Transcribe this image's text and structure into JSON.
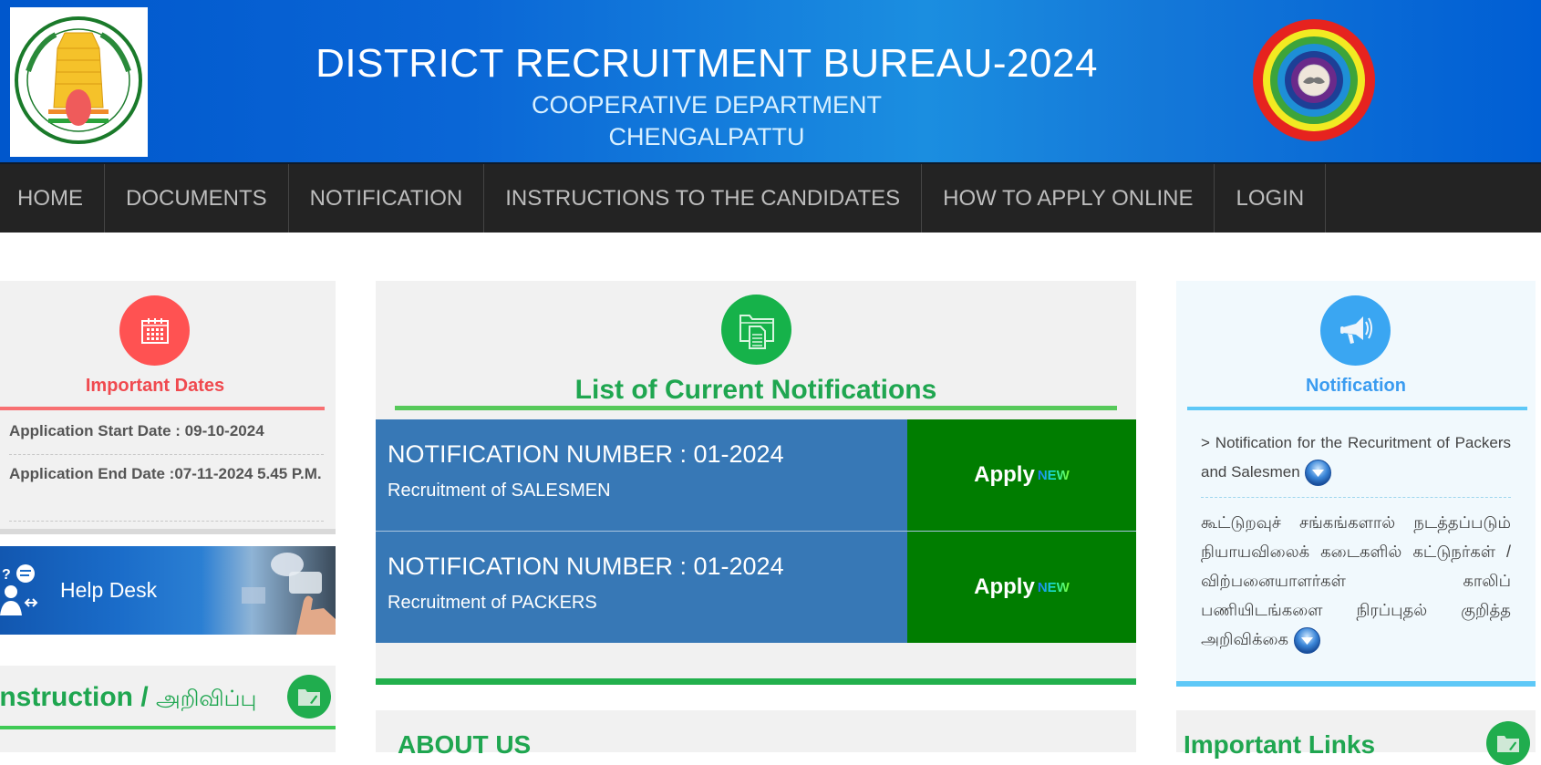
{
  "header": {
    "title": "DISTRICT RECRUITMENT BUREAU-2024",
    "subtitle_line1": "COOPERATIVE DEPARTMENT",
    "subtitle_line2": "CHENGALPATTU",
    "left_logo": "tamil-nadu-emblem",
    "right_logo": "cooperative-rainbow-logo"
  },
  "nav": {
    "items": [
      {
        "label": "HOME"
      },
      {
        "label": "DOCUMENTS"
      },
      {
        "label": "NOTIFICATION"
      },
      {
        "label": "INSTRUCTIONS TO THE CANDIDATES"
      },
      {
        "label": "HOW TO APPLY ONLINE"
      },
      {
        "label": "LOGIN"
      }
    ]
  },
  "important_dates": {
    "icon": "calendar-icon",
    "heading": "Important Dates",
    "start_date": "Application Start Date : 09-10-2024",
    "end_date": "Application End Date :07-11-2024 5.45 P.M."
  },
  "helpdesk": {
    "label": "Help Desk"
  },
  "instruction": {
    "title_en": "Instruction /",
    "title_ta": "அறிவிப்பு",
    "icon": "folder-icon"
  },
  "current_notifications": {
    "icon": "documents-folder-icon",
    "heading": "List of Current Notifications",
    "items": [
      {
        "number": "NOTIFICATION NUMBER : 01-2024",
        "description": "Recruitment of SALESMEN",
        "apply_label": "Apply",
        "badge": "NEW"
      },
      {
        "number": "NOTIFICATION NUMBER : 01-2024",
        "description": "Recruitment of PACKERS",
        "apply_label": "Apply",
        "badge": "NEW"
      }
    ]
  },
  "about": {
    "title": "ABOUT US"
  },
  "notification_panel": {
    "icon": "megaphone-icon",
    "heading": "Notification",
    "english_text": "> Notification for the Recuritment of Packers and Salesmen",
    "tamil_text": "கூட்டுறவுச் சங்கங்களால் நடத்தப்படும் நியாயவிலைக் கடைகளில் கட்டுநர்கள் / விற்பனையாளர்கள் காலிப் பணியிடங்களை நிரப்புதல் குறித்த அறிவிக்கை"
  },
  "important_links": {
    "title": "Important Links",
    "icon": "folder-icon"
  },
  "colors": {
    "header_blue": "#0057cc",
    "nav_bg": "#232323",
    "accent_red": "#ff5252",
    "accent_green": "#1fa650",
    "notif_blue": "#3778b6",
    "apply_green": "#007d00",
    "accent_sky": "#5ec8f7"
  }
}
